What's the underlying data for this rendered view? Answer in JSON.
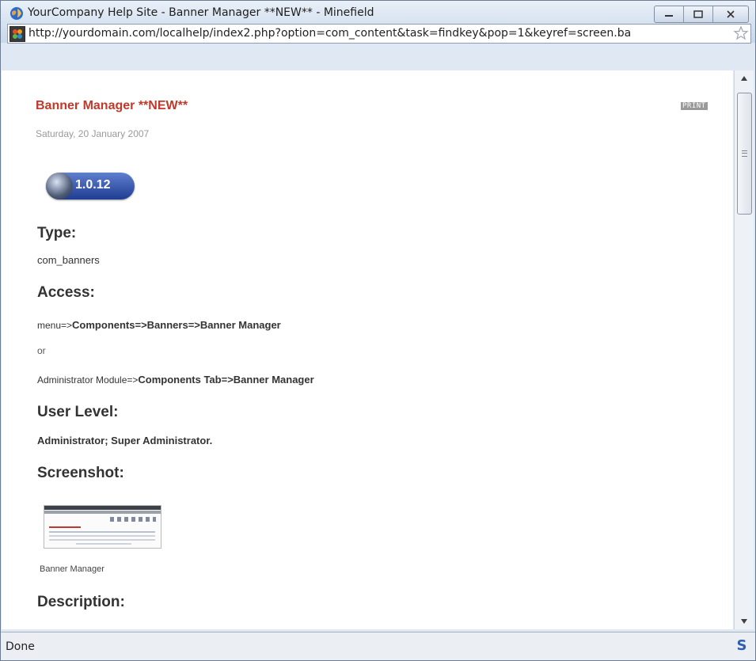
{
  "window": {
    "title": "YourCompany Help Site - Banner Manager **NEW** - Minefield",
    "url": "http://yourdomain.com/localhelp/index2.php?option=com_content&task=findkey&pop=1&keyref=screen.ba"
  },
  "article": {
    "title": "Banner Manager **NEW**",
    "print_label": "PRINT",
    "date": "Saturday, 20 January 2007",
    "version": "1.0.12",
    "type_heading": "Type:",
    "type_value": "com_banners",
    "access_heading": "Access:",
    "access_1_prefix": "menu=>",
    "access_1_path": "Components=>Banners=>Banner Manager",
    "access_or": "or",
    "access_2_prefix": "Administrator Module=>",
    "access_2_path": "Components Tab=>Banner Manager",
    "user_level_heading": "User Level:",
    "user_level_value": "Administrator; Super Administrator.",
    "screenshot_heading": "Screenshot:",
    "screenshot_caption": "Banner Manager",
    "description_heading": "Description:"
  },
  "status": {
    "text": "Done"
  },
  "icons": {
    "title": "globe-icon",
    "site": "joomla-favicon-icon",
    "bookmark": "star-icon",
    "status": "s-addon-icon"
  },
  "colors": {
    "title_accent": "#c0392b",
    "badge": "#2a4aa3"
  }
}
